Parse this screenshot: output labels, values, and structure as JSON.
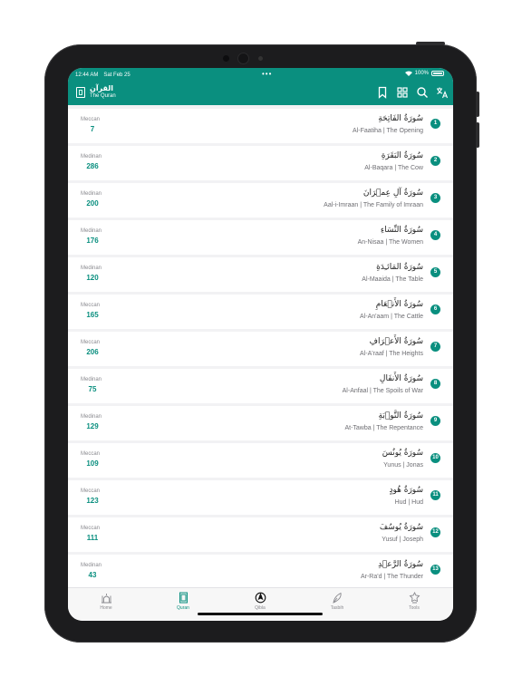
{
  "status_bar": {
    "time": "12:44 AM",
    "date": "Sat Feb 25",
    "battery": "100%"
  },
  "header": {
    "title_ar": "القرآن",
    "title_en": "The Quran",
    "actions": [
      "bookmark-icon",
      "grid-icon",
      "search-icon",
      "translate-icon"
    ],
    "color": "#0a8f7f"
  },
  "surahs": [
    {
      "number": "1",
      "name_ar": "سُورَةُ الفَاتِحَةِ",
      "name_en": "Al-Faatiha | The Opening",
      "revelation": "Meccan",
      "verses": "7"
    },
    {
      "number": "2",
      "name_ar": "سُورَةُ البَقَرَةِ",
      "name_en": "Al-Baqara | The Cow",
      "revelation": "Medinan",
      "verses": "286"
    },
    {
      "number": "3",
      "name_ar": "سُورَةُ آلِ عِمۡرَانَ",
      "name_en": "Aal-i-Imraan | The Family of Imraan",
      "revelation": "Medinan",
      "verses": "200"
    },
    {
      "number": "4",
      "name_ar": "سُورَةُ النِّسَاءِ",
      "name_en": "An-Nisaa | The Women",
      "revelation": "Medinan",
      "verses": "176"
    },
    {
      "number": "5",
      "name_ar": "سُورَةُ المَائـِدَةِ",
      "name_en": "Al-Maaida | The Table",
      "revelation": "Medinan",
      "verses": "120"
    },
    {
      "number": "6",
      "name_ar": "سُورَةُ الأَنۡعَامِ",
      "name_en": "Al-An'aam | The Cattle",
      "revelation": "Meccan",
      "verses": "165"
    },
    {
      "number": "7",
      "name_ar": "سُورَةُ الأَعۡرَافِ",
      "name_en": "Al-A'raaf | The Heights",
      "revelation": "Meccan",
      "verses": "206"
    },
    {
      "number": "8",
      "name_ar": "سُورَةُ الأَنفَالِ",
      "name_en": "Al-Anfaal | The Spoils of War",
      "revelation": "Medinan",
      "verses": "75"
    },
    {
      "number": "9",
      "name_ar": "سُورَةُ التَّوۡبَةِ",
      "name_en": "At-Tawba | The Repentance",
      "revelation": "Medinan",
      "verses": "129"
    },
    {
      "number": "10",
      "name_ar": "سُورَةُ يُونُسَ",
      "name_en": "Yunus | Jonas",
      "revelation": "Meccan",
      "verses": "109"
    },
    {
      "number": "11",
      "name_ar": "سُورَةُ هُودٍ",
      "name_en": "Hud | Hud",
      "revelation": "Meccan",
      "verses": "123"
    },
    {
      "number": "12",
      "name_ar": "سُورَةُ يُوسُفَ",
      "name_en": "Yusuf | Joseph",
      "revelation": "Meccan",
      "verses": "111"
    },
    {
      "number": "13",
      "name_ar": "سُورَةُ الرَّعۡدِ",
      "name_en": "Ar-Ra'd | The Thunder",
      "revelation": "Medinan",
      "verses": "43"
    }
  ],
  "tabs": [
    {
      "label": "Home",
      "icon": "mosque-icon",
      "active": false
    },
    {
      "label": "Quran",
      "icon": "quran-icon",
      "active": true
    },
    {
      "label": "Qibla",
      "icon": "compass-icon",
      "active": false
    },
    {
      "label": "Tasbih",
      "icon": "tasbih-icon",
      "active": false
    },
    {
      "label": "Tools",
      "icon": "tools-icon",
      "active": false
    }
  ]
}
